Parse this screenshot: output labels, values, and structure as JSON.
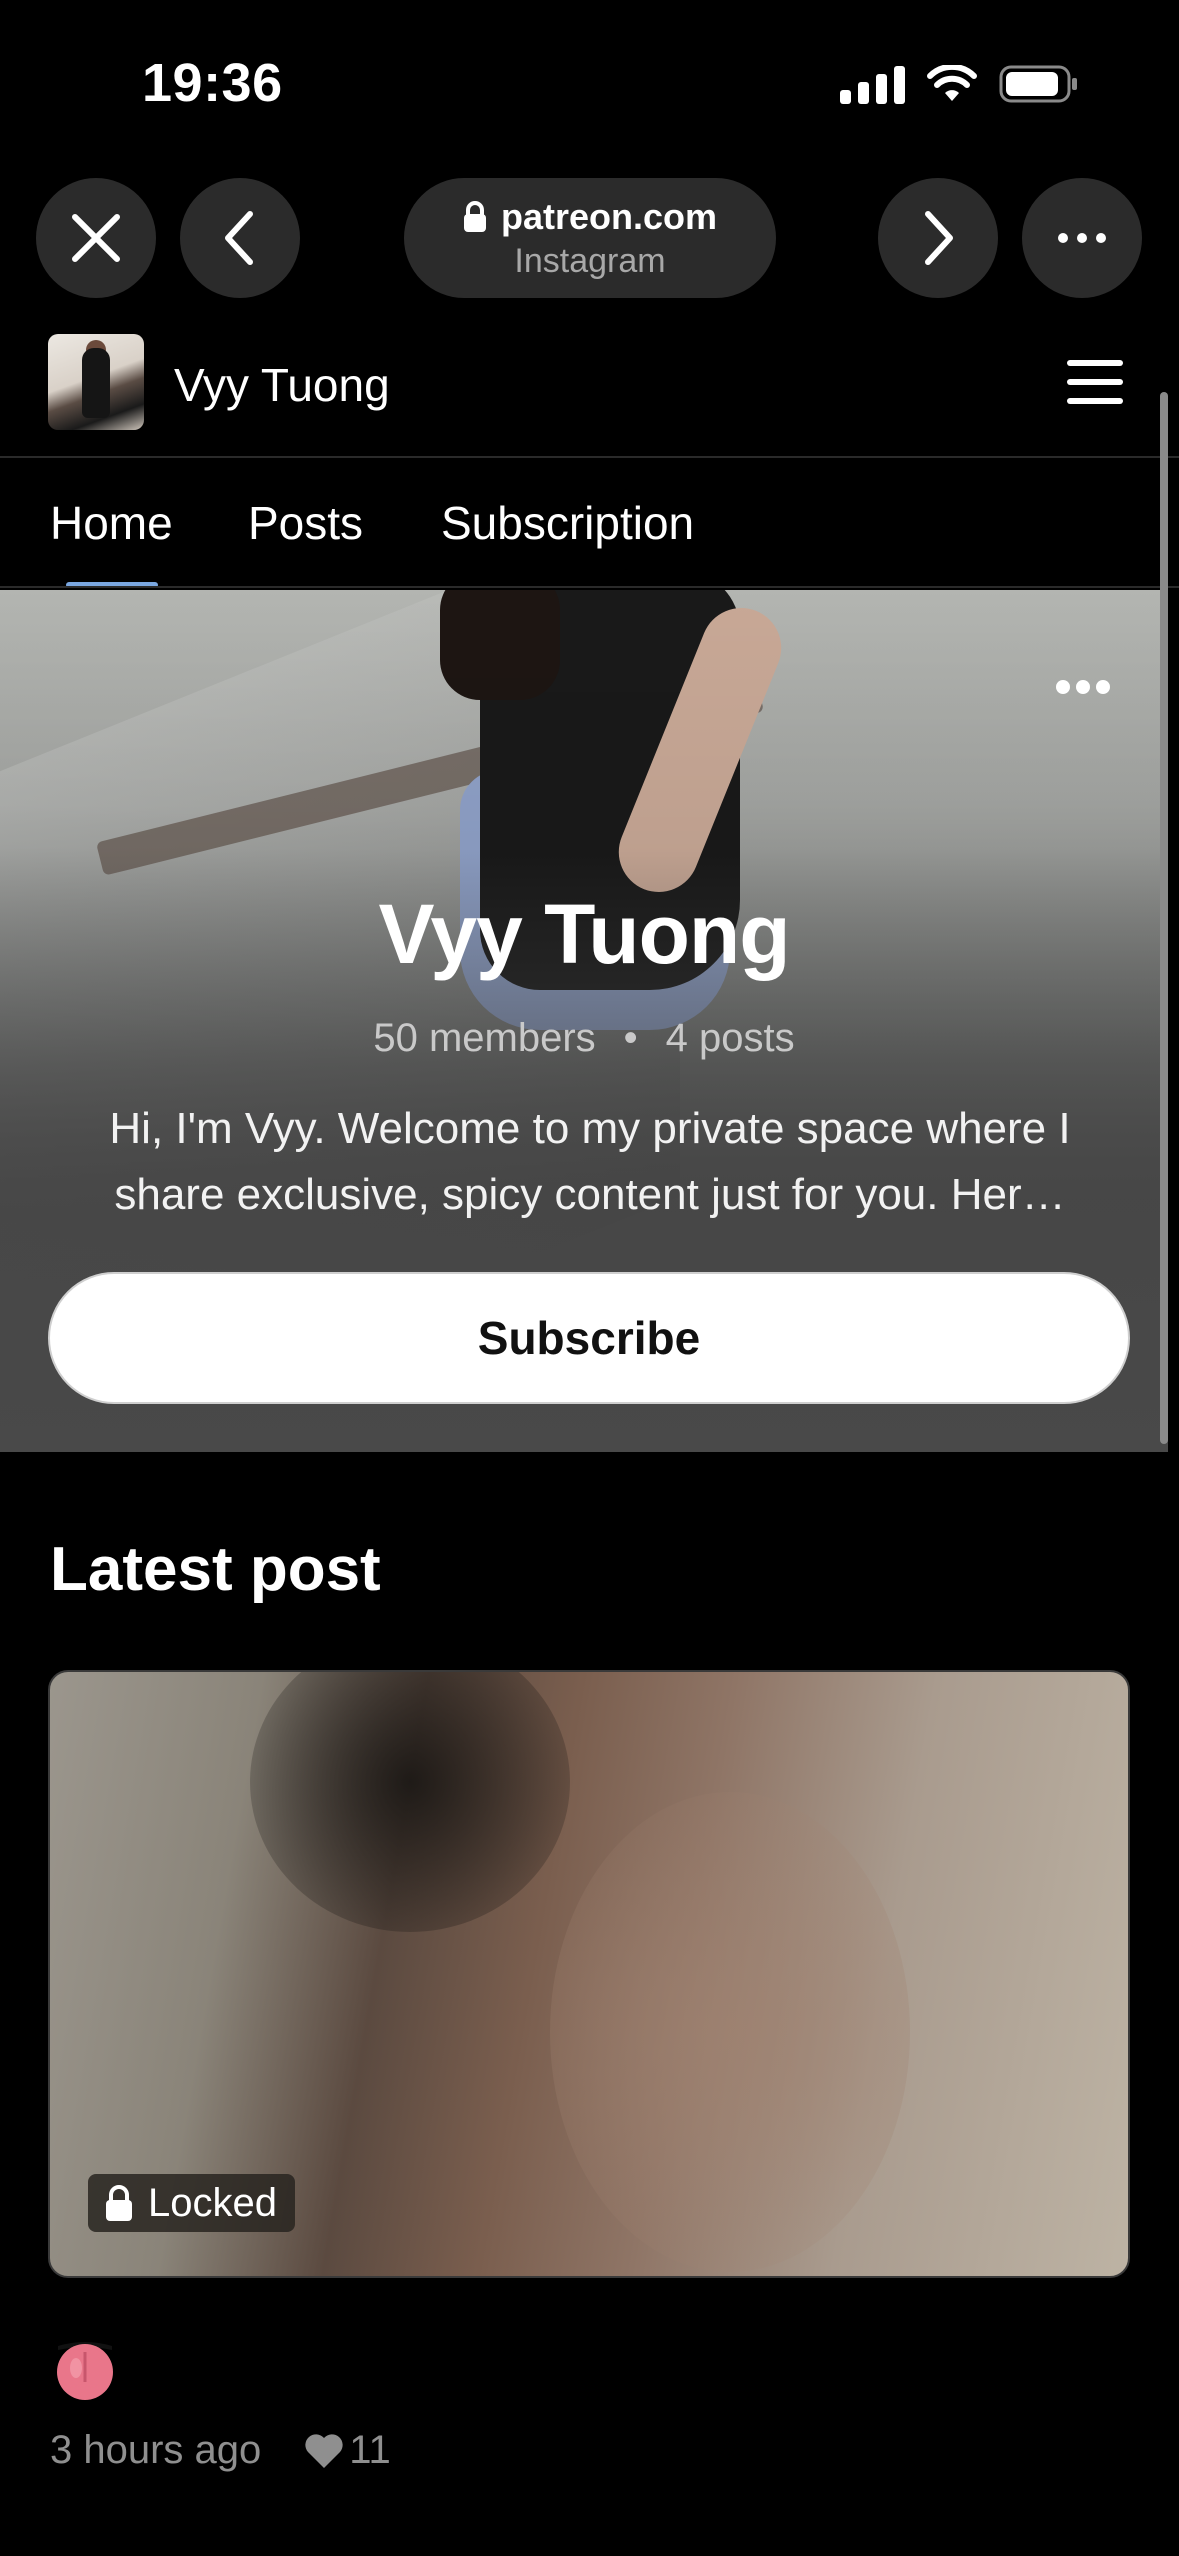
{
  "status_bar": {
    "time": "19:36",
    "icons": [
      "signal-icon",
      "wifi-icon",
      "battery-icon"
    ]
  },
  "browser": {
    "domain": "patreon.com",
    "source": "Instagram",
    "icons": [
      "close-icon",
      "back-icon",
      "lock-icon",
      "forward-icon",
      "more-icon"
    ]
  },
  "creator": {
    "name": "Vyy Tuong"
  },
  "tabs": [
    {
      "label": "Home",
      "selected": true
    },
    {
      "label": "Posts",
      "selected": false
    },
    {
      "label": "Subscription",
      "selected": false
    }
  ],
  "hero": {
    "title": "Vyy Tuong",
    "members": "50 members",
    "separator": "•",
    "posts": "4 posts",
    "description": "Hi, I'm Vyy. Welcome to my private space where I share exclusive, spicy content just for you. Her…",
    "subscribe_label": "Subscribe"
  },
  "latest": {
    "title": "Latest post",
    "locked_label": "Locked",
    "time_ago": "3 hours ago",
    "likes": "11"
  },
  "colors": {
    "background": "#000000",
    "button_bg": "#2b2b2b",
    "tab_indicator": "#7aa7e0",
    "muted_text": "#8f8f8f"
  }
}
